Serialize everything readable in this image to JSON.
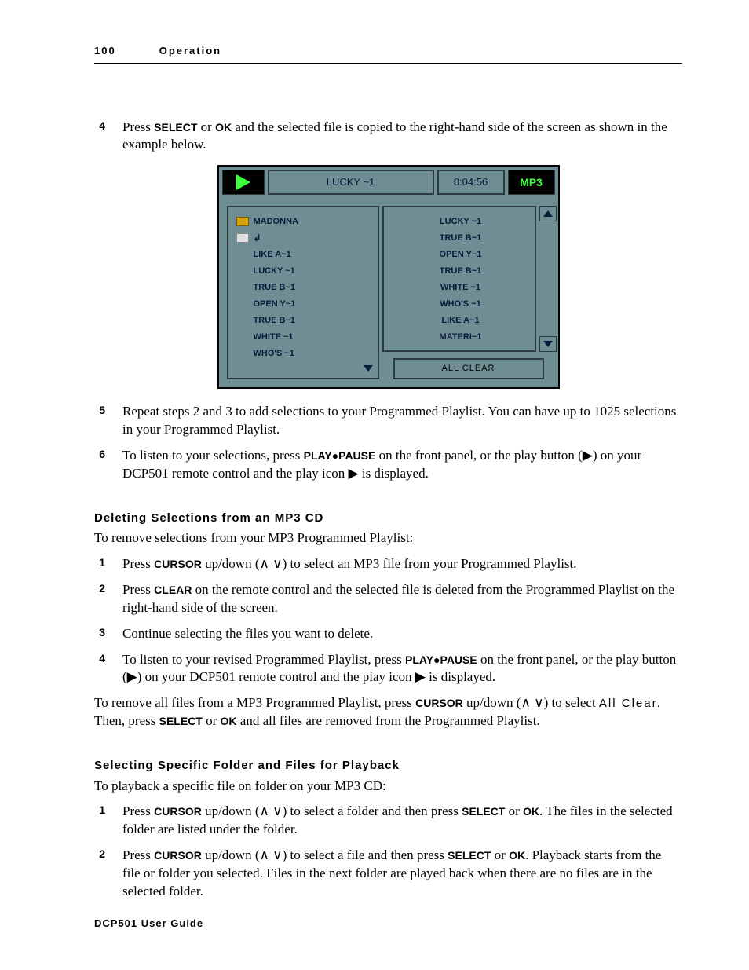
{
  "header": {
    "page_num": "100",
    "section": "Operation"
  },
  "footer": "DCP501 User Guide",
  "block1_steps": [
    {
      "n": "4",
      "pre": "Press ",
      "b1": "SELECT",
      "mid": " or ",
      "b2": "OK",
      "post": " and the selected file is copied to the right-hand side of the screen as shown in the example below."
    },
    {
      "n": "5",
      "text": "Repeat steps 2 and 3 to add selections to your Programmed Playlist. You can have up to 1025 selections in your Programmed Playlist."
    },
    {
      "n": "6",
      "pre": "To listen to your selections, press ",
      "b1": "PLAY●PAUSE",
      "mid": " on the front panel, or the play button (▶) on your DCP501 remote control and the play icon ▶ is displayed.",
      "b2": "",
      "post": ""
    }
  ],
  "device": {
    "title": "LUCKY ~1",
    "time": "0:04:56",
    "badge": "MP3",
    "left_header": "MADONNA",
    "left_items": [
      "LIKE A~1",
      "LUCKY ~1",
      "TRUE B~1",
      "OPEN Y~1",
      "TRUE B~1",
      "WHITE ~1",
      "WHO'S ~1"
    ],
    "right_items": [
      "LUCKY ~1",
      "TRUE B~1",
      "OPEN Y~1",
      "TRUE B~1",
      "WHITE ~1",
      "WHO'S ~1",
      "LIKE A~1",
      "MATERI~1"
    ],
    "all_clear": "ALL CLEAR"
  },
  "del_heading": "Deleting Selections from an MP3 CD",
  "del_intro": "To remove selections from your MP3 Programmed Playlist:",
  "del_steps": {
    "s1": {
      "n": "1",
      "pre": "Press ",
      "b1": "CURSOR",
      "mid": " up/down (∧ ∨) to select an MP3 file from your Programmed Playlist."
    },
    "s2": {
      "n": "2",
      "pre": "Press ",
      "b1": "CLEAR",
      "mid": " on the remote control and the selected file is deleted from the Programmed Playlist on the right-hand side of the screen."
    },
    "s3": {
      "n": "3",
      "text": "Continue selecting the files you want to delete."
    },
    "s4": {
      "n": "4",
      "pre": "To listen to your revised Programmed Playlist, press ",
      "b1": "PLAY●PAUSE",
      "mid": " on the front panel, or the play button (▶) on your DCP501 remote control and the play icon ▶ is displayed."
    }
  },
  "del_tail": {
    "pre": "To remove all files from a MP3 Programmed Playlist, press ",
    "b1": "CURSOR",
    "mid1": " up/down (∧ ∨) to select ",
    "allclear": "All Clear.",
    "mid2": " Then, press ",
    "b2": "SELECT",
    "mid3": " or ",
    "b3": "OK",
    "post": " and all files are removed from the Programmed Playlist."
  },
  "sel_heading": "Selecting Specific Folder and Files for Playback",
  "sel_intro": "To playback a specific file on folder on your MP3 CD:",
  "sel_steps": {
    "s1": {
      "n": "1",
      "pre": "Press ",
      "b1": "CURSOR",
      "mid1": " up/down (∧ ∨) to select a folder and then press ",
      "b2": "SELECT",
      "mid2": " or ",
      "b3": "OK",
      "post": ". The files in the selected folder are listed under the folder."
    },
    "s2": {
      "n": "2",
      "pre": "Press ",
      "b1": "CURSOR",
      "mid1": " up/down (∧ ∨) to select a file and then press ",
      "b2": "SELECT",
      "mid2": " or ",
      "b3": "OK",
      "post": ". Playback starts from the file or folder you selected. Files in the next folder are played back when there are no files are in the selected folder."
    }
  }
}
